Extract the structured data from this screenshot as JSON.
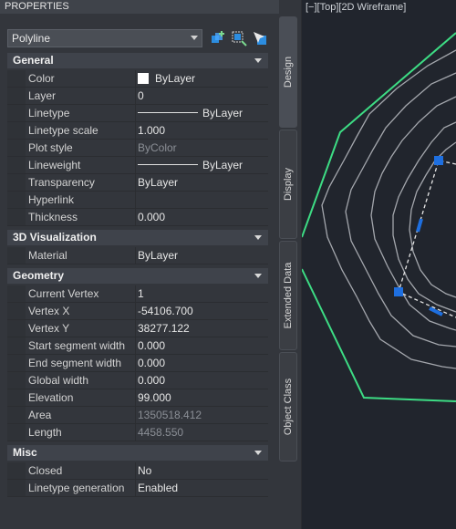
{
  "palette": {
    "title": "PROPERTIES",
    "selection": "Polyline",
    "toolbar": [
      "add-selected-icon",
      "quick-select-icon",
      "select-objects-icon"
    ]
  },
  "sections": {
    "general": "General",
    "viz3d": "3D Visualization",
    "geometry": "Geometry",
    "misc": "Misc"
  },
  "general": {
    "color": {
      "label": "Color",
      "value": "ByLayer"
    },
    "layer": {
      "label": "Layer",
      "value": "0"
    },
    "linetype": {
      "label": "Linetype",
      "value": "ByLayer"
    },
    "linetype_scale": {
      "label": "Linetype scale",
      "value": "1.000"
    },
    "plot_style": {
      "label": "Plot style",
      "value": "ByColor"
    },
    "lineweight": {
      "label": "Lineweight",
      "value": "ByLayer"
    },
    "transparency": {
      "label": "Transparency",
      "value": "ByLayer"
    },
    "hyperlink": {
      "label": "Hyperlink",
      "value": ""
    },
    "thickness": {
      "label": "Thickness",
      "value": "0.000"
    }
  },
  "viz3d": {
    "material": {
      "label": "Material",
      "value": "ByLayer"
    }
  },
  "geometry": {
    "current_vertex": {
      "label": "Current Vertex",
      "value": "1"
    },
    "vertex_x": {
      "label": "Vertex X",
      "value": "-54106.700"
    },
    "vertex_y": {
      "label": "Vertex Y",
      "value": "38277.122"
    },
    "start_width": {
      "label": "Start segment width",
      "value": "0.000"
    },
    "end_width": {
      "label": "End segment width",
      "value": "0.000"
    },
    "global_width": {
      "label": "Global width",
      "value": "0.000"
    },
    "elevation": {
      "label": "Elevation",
      "value": "99.000"
    },
    "area": {
      "label": "Area",
      "value": "1350518.412"
    },
    "length": {
      "label": "Length",
      "value": "4458.550"
    }
  },
  "misc": {
    "closed": {
      "label": "Closed",
      "value": "No"
    },
    "linetype_generation": {
      "label": "Linetype generation",
      "value": "Enabled"
    }
  },
  "tabs": [
    "Design",
    "Display",
    "Extended Data",
    "Object Class"
  ],
  "viewport": {
    "label": "[−][Top][2D Wireframe]",
    "colors": {
      "boundary": "#3ddc84",
      "contour": "#a4a7ad",
      "selected": "#e6e6e6",
      "grip": "#1e6fe0"
    }
  }
}
